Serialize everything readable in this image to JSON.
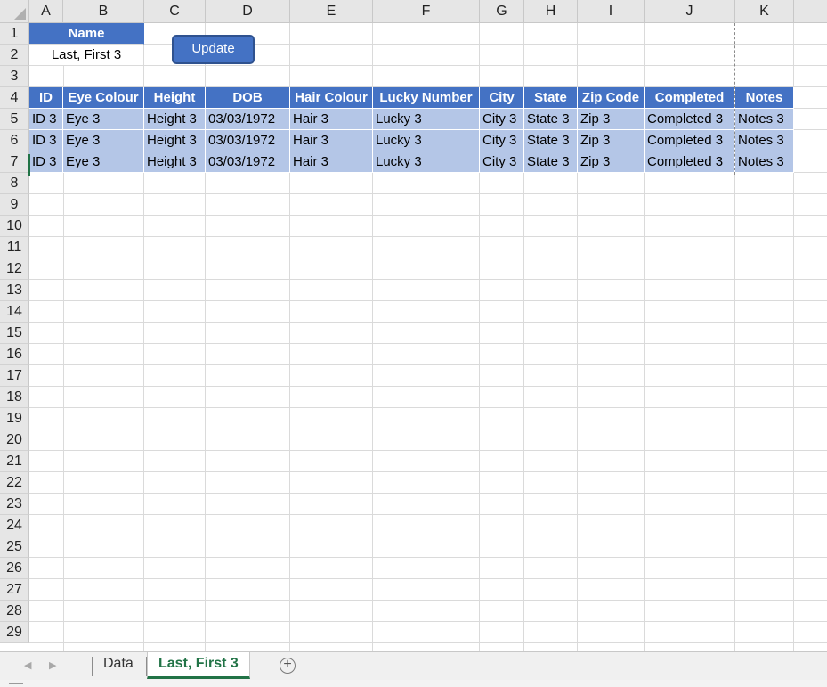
{
  "columns": [
    "A",
    "B",
    "C",
    "D",
    "E",
    "F",
    "G",
    "H",
    "I",
    "J",
    "K"
  ],
  "rows": [
    "1",
    "2",
    "3",
    "4",
    "5",
    "6",
    "7",
    "8",
    "9",
    "10",
    "11",
    "12",
    "13",
    "14",
    "15",
    "16",
    "17",
    "18",
    "19",
    "20",
    "21",
    "22",
    "23",
    "24",
    "25",
    "26",
    "27",
    "28",
    "29"
  ],
  "name_label": "Name",
  "name_value": "Last, First 3",
  "update_button": "Update",
  "table_headers": [
    "ID",
    "Eye Colour",
    "Height",
    "DOB",
    "Hair Colour",
    "Lucky Number",
    "City",
    "State",
    "Zip Code",
    "Completed",
    "Notes"
  ],
  "table_rows": [
    [
      "ID 3",
      "Eye 3",
      "Height 3",
      "03/03/1972",
      "Hair 3",
      "Lucky 3",
      "City 3",
      "State 3",
      "Zip 3",
      "Completed 3",
      "Notes 3"
    ],
    [
      "ID 3",
      "Eye 3",
      "Height 3",
      "03/03/1972",
      "Hair 3",
      "Lucky 3",
      "City 3",
      "State 3",
      "Zip 3",
      "Completed 3",
      "Notes 3"
    ],
    [
      "ID 3",
      "Eye 3",
      "Height 3",
      "03/03/1972",
      "Hair 3",
      "Lucky 3",
      "City 3",
      "State 3",
      "Zip 3",
      "Completed 3",
      "Notes 3"
    ]
  ],
  "sheet_tabs": [
    "Data",
    "Last, First 3"
  ],
  "active_tab": "Last, First 3",
  "colors": {
    "header_blue": "#4472c4",
    "row_band": "#b4c6e7",
    "excel_green": "#217346"
  },
  "icons": {
    "prev_sheet": "chevron-left-icon",
    "next_sheet": "chevron-right-icon",
    "add_sheet": "plus-circle-icon"
  }
}
